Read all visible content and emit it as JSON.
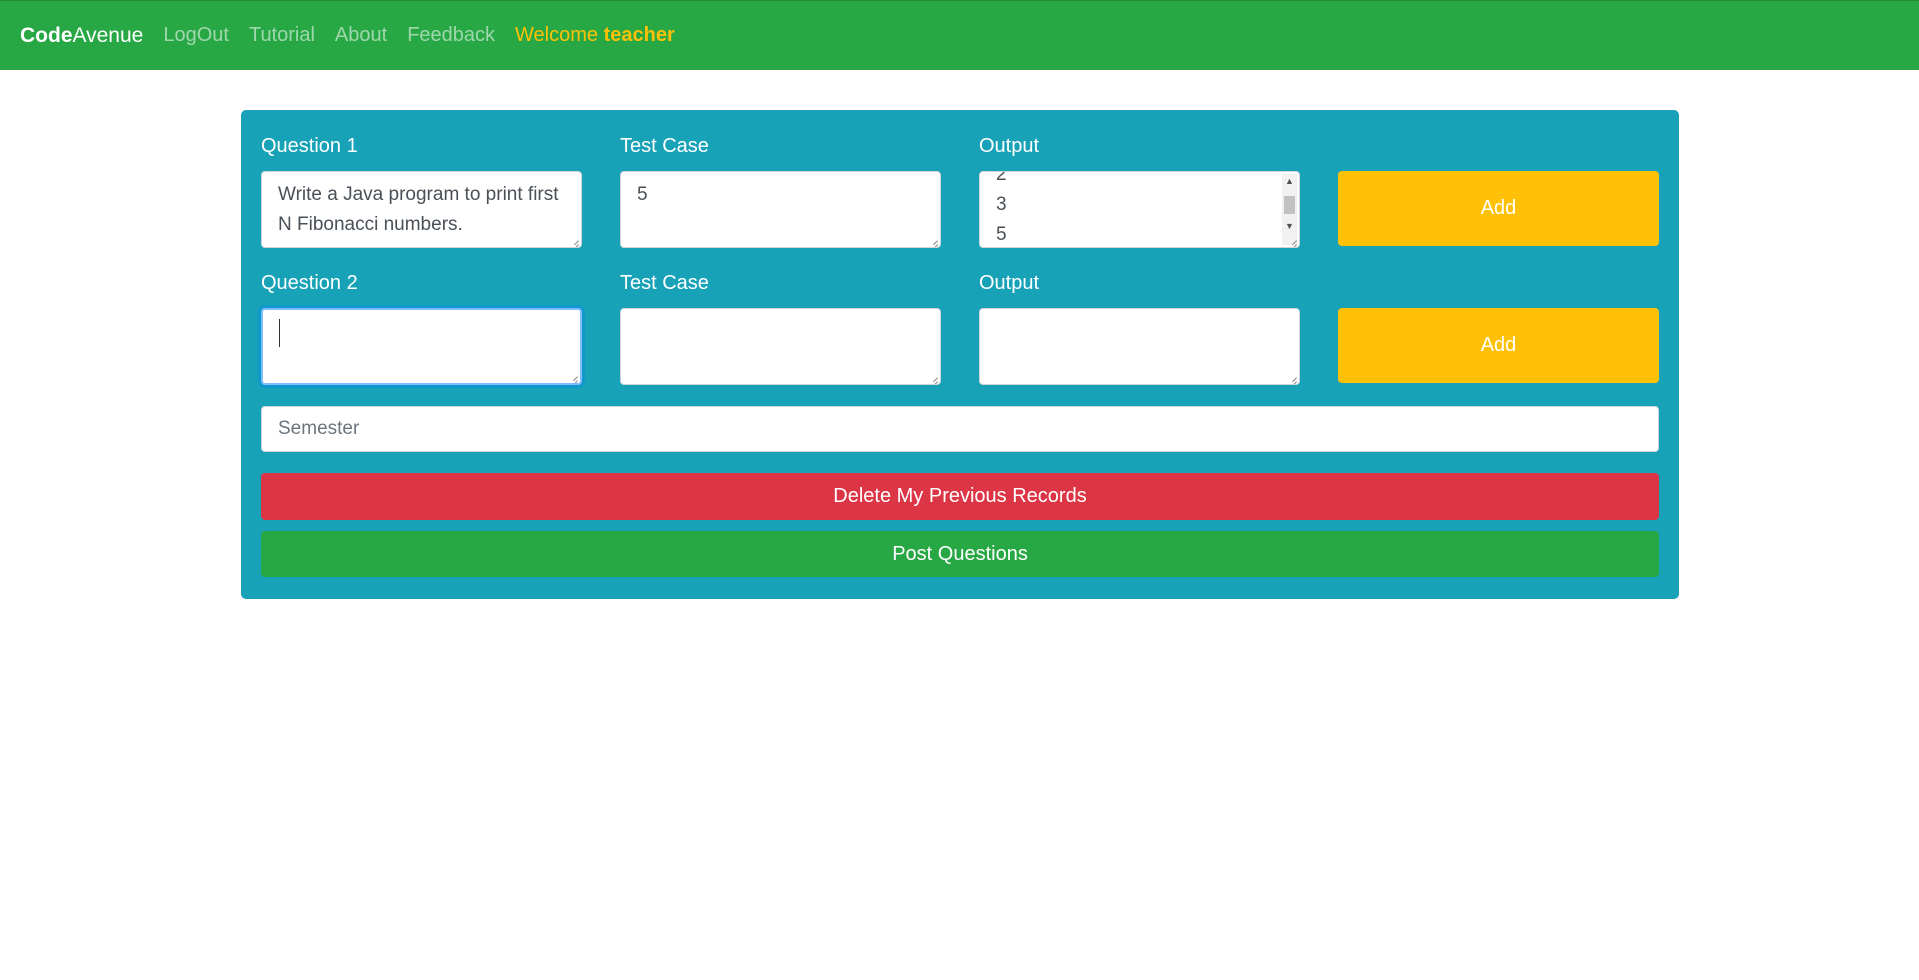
{
  "navbar": {
    "brand_bold": "Code",
    "brand_rest": "Avenue",
    "links": [
      "LogOut",
      "Tutorial",
      "About",
      "Feedback"
    ],
    "welcome_prefix": "Welcome",
    "welcome_user": "teacher"
  },
  "questions": [
    {
      "question_label": "Question 1",
      "question_value": "Write a Java program to print first N Fibonacci numbers.",
      "testcase_label": "Test Case",
      "testcase_value": "5",
      "output_label": "Output",
      "output_lines": [
        "2",
        "3",
        "5"
      ],
      "add_label": "Add"
    },
    {
      "question_label": "Question 2",
      "question_value": "",
      "testcase_label": "Test Case",
      "testcase_value": "",
      "output_label": "Output",
      "output_lines": [],
      "add_label": "Add"
    }
  ],
  "semester": {
    "placeholder": "Semester"
  },
  "buttons": {
    "delete": "Delete My Previous Records",
    "post": "Post Questions"
  },
  "colors": {
    "navbar": "#28a745",
    "panel": "#17a2b8",
    "add": "#ffc107",
    "danger": "#dc3545",
    "success": "#28a745",
    "welcome": "#ffc107"
  }
}
